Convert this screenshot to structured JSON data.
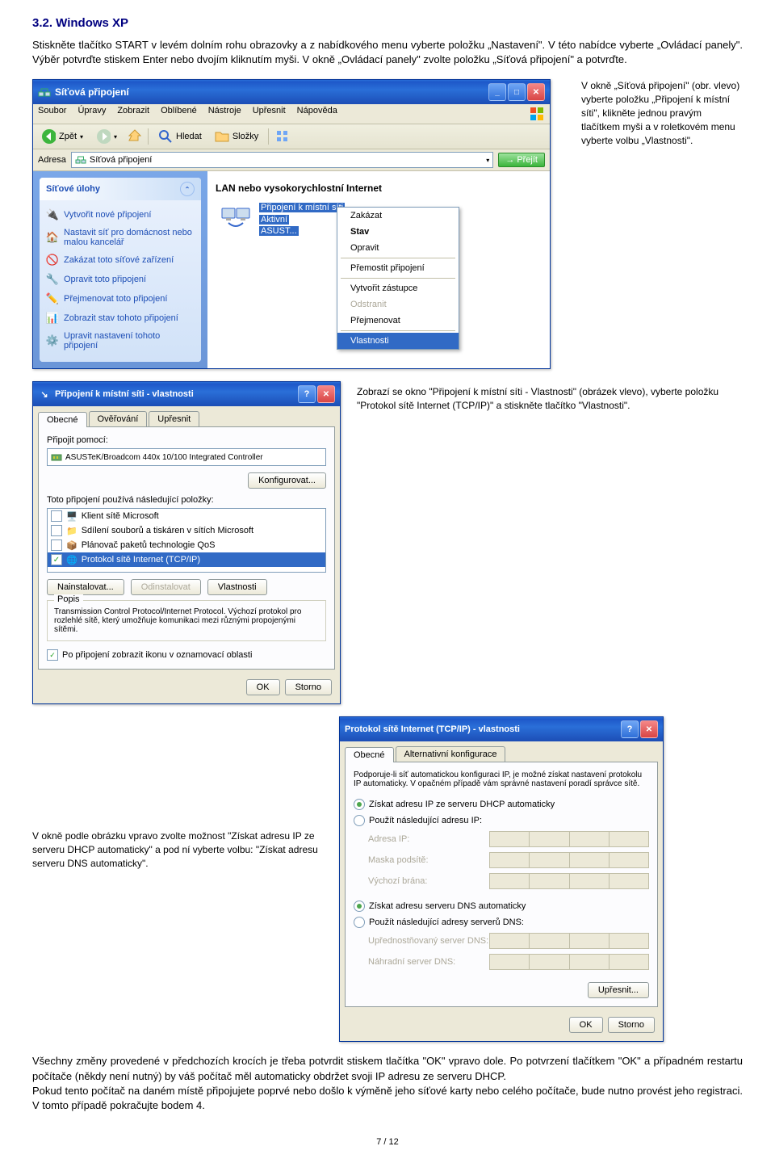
{
  "heading": "3.2. Windows XP",
  "intro": "Stiskněte tlačítko START v levém dolním rohu obrazovky a z nabídkového menu vyberte položku „Nastavení\". V této nabídce vyberte „Ovládací panely\". Výběr potvrďte stiskem Enter nebo dvojím kliknutím myši. V okně „Ovládací panely\" zvolte položku „Síťová  připojení\" a potvrďte.",
  "side1": "V okně „Síťová připojení\" (obr. vlevo) vyberte položku „Připojení k místní síti\", klikněte jednou pravým tlačítkem myši a v roletkovém menu vyberte volbu „Vlastnosti\".",
  "mid1": "Zobrazí se okno \"Připojení k místní síti - Vlastnosti\" (obrázek vlevo), vyberte  položku \"Protokol sítě Internet (TCP/IP)\"  a stiskněte tlačítko \"Vlastnosti\".",
  "side2": "V okně podle obrázku vpravo zvolte možnost \"Získat adresu IP ze serveru DHCP automaticky\" a pod ní vyberte volbu: \"Získat adresu serveru DNS automaticky\".",
  "outro": "Všechny změny provedené v předchozích krocích je třeba potvrdit stiskem tlačítka \"OK\" vpravo dole. Po potvrzení tlačítkem \"OK\" a případném restartu počítače (někdy není nutný) by váš počítač měl automaticky obdržet svoji IP adresu ze serveru DHCP.\nPokud tento počítač na daném místě připojujete poprvé nebo došlo k výměně jeho síťové karty nebo celého počítače, bude nutno provést jeho registraci. V tomto případě pokračujte bodem 4.",
  "footer": "7 / 12",
  "win1": {
    "title": "Síťová připojení",
    "menu": [
      "Soubor",
      "Úpravy",
      "Zobrazit",
      "Oblíbené",
      "Nástroje",
      "Upřesnit",
      "Nápověda"
    ],
    "back": "Zpět",
    "search": "Hledat",
    "folders": "Složky",
    "addr_label": "Adresa",
    "addr_value": "Síťová připojení",
    "go": "Přejít",
    "tasks_header": "Síťové úlohy",
    "tasks": [
      "Vytvořit nové připojení",
      "Nastavit síť pro domácnost nebo malou kancelář",
      "Zakázat toto síťové zařízení",
      "Opravit toto připojení",
      "Přejmenovat toto připojení",
      "Zobrazit stav tohoto připojení",
      "Upravit nastavení tohoto připojení"
    ],
    "section": "LAN nebo vysokorychlostní Internet",
    "conn_line1": "Připojení k místní síti",
    "conn_line2": "Aktivní",
    "conn_line3": "ASUST...",
    "ctx": {
      "disable": "Zakázat",
      "status": "Stav",
      "repair": "Opravit",
      "bridge": "Přemostit připojení",
      "shortcut": "Vytvořit zástupce",
      "delete": "Odstranit",
      "rename": "Přejmenovat",
      "props": "Vlastnosti"
    }
  },
  "dlg1": {
    "title": "Připojení k místní síti - vlastnosti",
    "tabs": [
      "Obecné",
      "Ověřování",
      "Upřesnit"
    ],
    "connect_using": "Připojit pomocí:",
    "adapter": "ASUSTeK/Broadcom 440x 10/100 Integrated Controller",
    "configure": "Konfigurovat...",
    "uses": "Toto připojení používá následující položky:",
    "items": [
      {
        "chk": false,
        "label": "Klient sítě Microsoft"
      },
      {
        "chk": false,
        "label": "Sdílení souborů a tiskáren v sítích Microsoft"
      },
      {
        "chk": false,
        "label": "Plánovač paketů technologie QoS"
      },
      {
        "chk": true,
        "label": "Protokol sítě Internet (TCP/IP)",
        "sel": true
      }
    ],
    "install": "Nainstalovat...",
    "uninstall": "Odinstalovat",
    "props": "Vlastnosti",
    "desc_label": "Popis",
    "desc": "Transmission Control Protocol/Internet Protocol. Výchozí protokol pro rozlehlé sítě, který umožňuje komunikaci mezi různými propojenými sítěmi.",
    "show_icon": "Po připojení zobrazit ikonu v oznamovací oblasti",
    "ok": "OK",
    "cancel": "Storno"
  },
  "dlg2": {
    "title": "Protokol sítě Internet (TCP/IP) - vlastnosti",
    "tabs": [
      "Obecné",
      "Alternativní konfigurace"
    ],
    "desc": "Podporuje-li síť automatickou konfiguraci IP, je možné získat nastavení protokolu IP automaticky. V opačném případě vám správné nastavení poradí správce sítě.",
    "r1": "Získat adresu IP ze serveru DHCP automaticky",
    "r2": "Použít následující adresu IP:",
    "ip": "Adresa IP:",
    "mask": "Maska podsítě:",
    "gw": "Výchozí brána:",
    "r3": "Získat adresu serveru DNS automaticky",
    "r4": "Použít následující adresy serverů DNS:",
    "dns1": "Upřednostňovaný server DNS:",
    "dns2": "Náhradní server DNS:",
    "adv": "Upřesnit...",
    "ok": "OK",
    "cancel": "Storno"
  }
}
